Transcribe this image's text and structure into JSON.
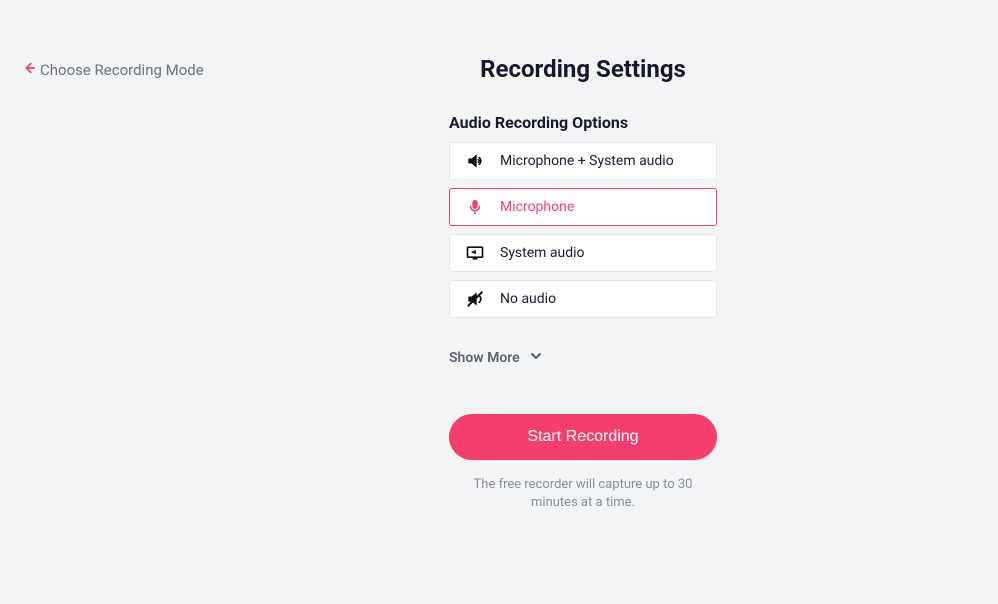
{
  "colors": {
    "accent": "#f43f6e",
    "background": "#f2f4f6"
  },
  "back_link": {
    "label": "Choose Recording Mode"
  },
  "page_title": "Recording Settings",
  "audio_section": {
    "title": "Audio Recording Options",
    "options": [
      {
        "label": "Microphone + System audio",
        "icon": "speaker-icon",
        "selected": false
      },
      {
        "label": "Microphone",
        "icon": "microphone-icon",
        "selected": true
      },
      {
        "label": "System audio",
        "icon": "monitor-audio-icon",
        "selected": false
      },
      {
        "label": "No audio",
        "icon": "mute-icon",
        "selected": false
      }
    ]
  },
  "show_more_label": "Show More",
  "start_button_label": "Start Recording",
  "disclaimer": "The free recorder will capture up to 30 minutes at a time."
}
